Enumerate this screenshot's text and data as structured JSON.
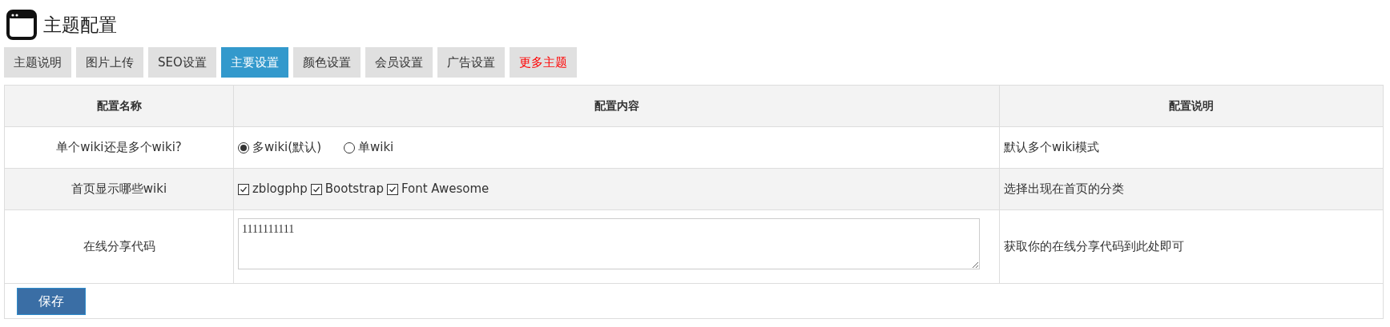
{
  "page_title": "主题配置",
  "tabs": [
    {
      "label": "主题说明",
      "selected": false,
      "highlight": false
    },
    {
      "label": "图片上传",
      "selected": false,
      "highlight": false
    },
    {
      "label": "SEO设置",
      "selected": false,
      "highlight": false
    },
    {
      "label": "主要设置",
      "selected": true,
      "highlight": false
    },
    {
      "label": "颜色设置",
      "selected": false,
      "highlight": false
    },
    {
      "label": "会员设置",
      "selected": false,
      "highlight": false
    },
    {
      "label": "广告设置",
      "selected": false,
      "highlight": false
    },
    {
      "label": "更多主题",
      "selected": false,
      "highlight": true
    }
  ],
  "table": {
    "columns": [
      "配置名称",
      "配置内容",
      "配置说明"
    ],
    "rows": [
      {
        "name": "单个wiki还是多个wiki?",
        "kind": "radio",
        "options": [
          {
            "label": "多wiki(默认)",
            "selected": true
          },
          {
            "label": "单wiki",
            "selected": false
          }
        ],
        "description": "默认多个wiki模式"
      },
      {
        "name": "首页显示哪些wiki",
        "kind": "checkbox",
        "options": [
          {
            "label": "zblogphp",
            "checked": true
          },
          {
            "label": "Bootstrap",
            "checked": true
          },
          {
            "label": "Font Awesome",
            "checked": true
          }
        ],
        "description": "选择出现在首页的分类"
      },
      {
        "name": "在线分享代码",
        "kind": "textarea",
        "value": "1111111111",
        "description": "获取你的在线分享代码到此处即可"
      }
    ]
  },
  "save_button": "保存"
}
